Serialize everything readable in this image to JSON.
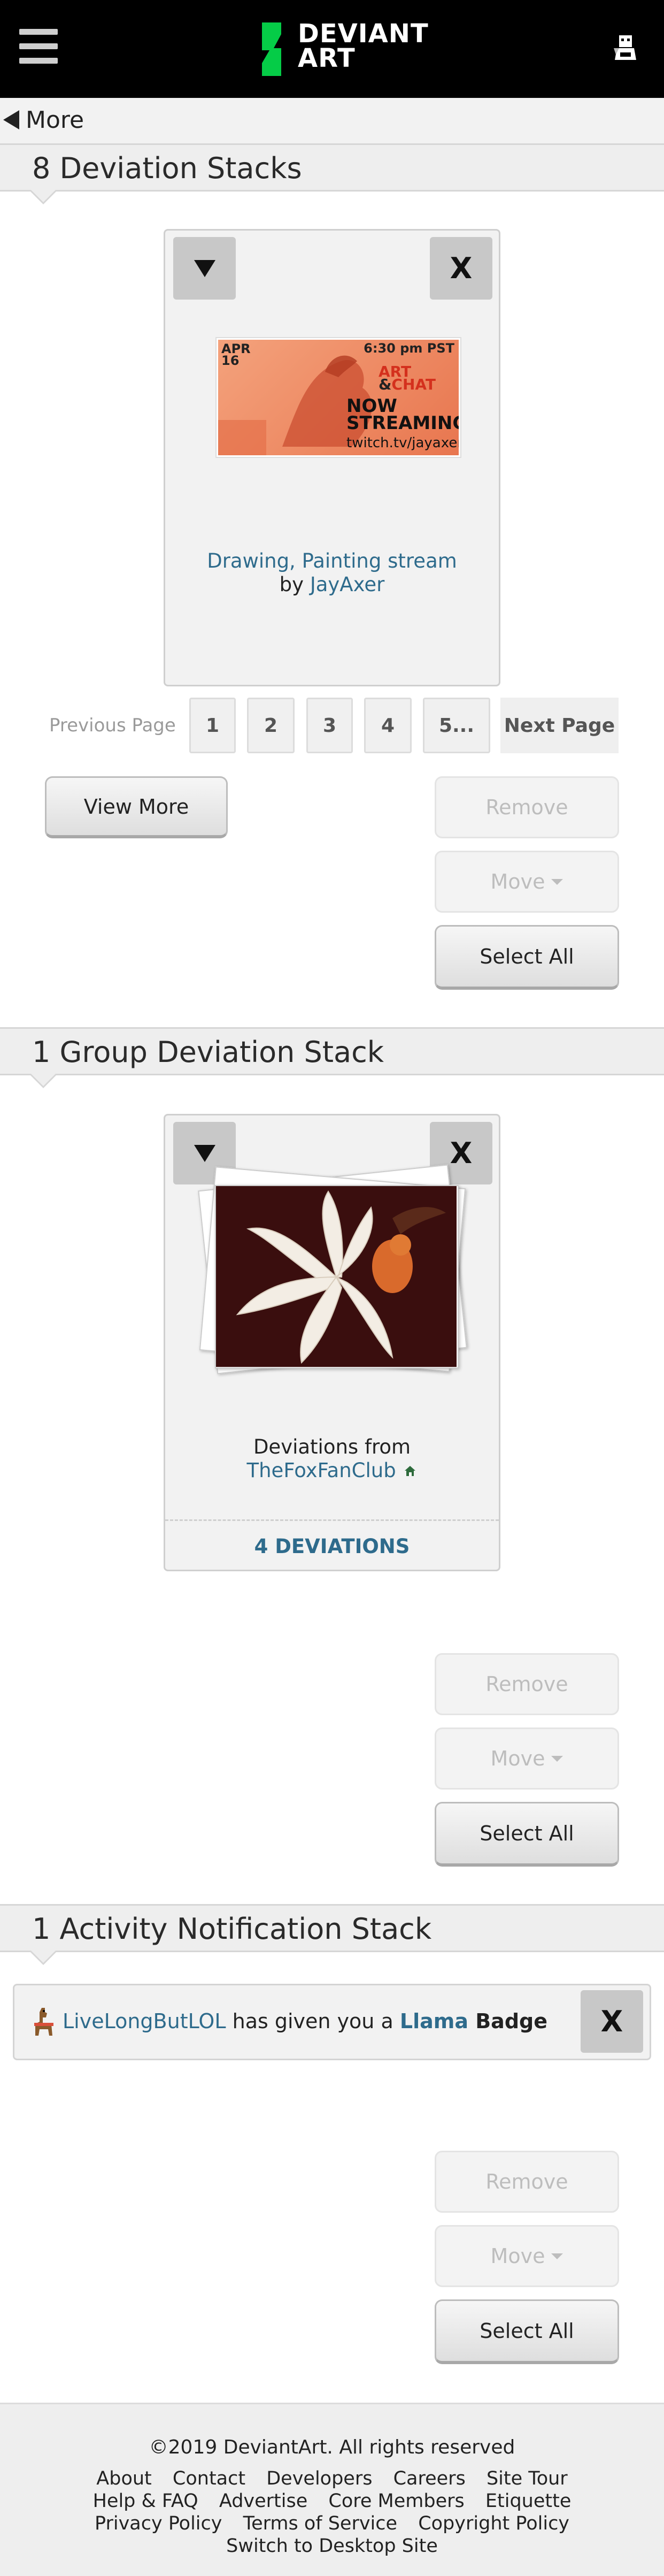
{
  "header": {
    "logo_line1": "DEVIANT",
    "logo_line2": "ART",
    "logo_color": "#05cc47"
  },
  "nav": {
    "more_label": "More"
  },
  "sections": {
    "deviations": {
      "title": "8 Deviation Stacks",
      "card": {
        "collapse_icon": "triangle-down-icon",
        "close_label": "X",
        "thumbnail": {
          "date_month": "APR",
          "date_day": "16",
          "time": "6:30 pm PST",
          "line_art": "ART",
          "line_amp": "&",
          "line_chat": "CHAT",
          "line_now": "NOW",
          "line_streaming": "STREAMING",
          "url": "twitch.tv/jayaxer"
        },
        "title": "Drawing, Painting stream",
        "by_label": "by",
        "author": "JayAxer"
      },
      "pagination": {
        "previous": "Previous Page",
        "pages": [
          "1",
          "2",
          "3",
          "4",
          "5..."
        ],
        "next": "Next Page"
      },
      "view_more": "View More",
      "remove": "Remove",
      "move": "Move",
      "select_all": "Select All"
    },
    "group": {
      "title": "1 Group Deviation Stack",
      "card": {
        "close_label": "X",
        "caption": "Deviations from",
        "group_name": "TheFoxFanClub",
        "count": "4 DEVIATIONS"
      },
      "remove": "Remove",
      "move": "Move",
      "select_all": "Select All"
    },
    "activity": {
      "title": "1 Activity Notification Stack",
      "notification": {
        "user": "LiveLongButLOL",
        "text": "has given you a",
        "badge": "Llama",
        "badge_suffix": "Badge",
        "close_label": "X"
      },
      "remove": "Remove",
      "move": "Move",
      "select_all": "Select All"
    }
  },
  "footer": {
    "copyright": "©2019 DeviantArt. All rights reserved",
    "links": [
      "About",
      "Contact",
      "Developers",
      "Careers",
      "Site Tour",
      "Help & FAQ",
      "Advertise",
      "Core Members",
      "Etiquette",
      "Privacy Policy",
      "Terms of Service",
      "Copyright Policy",
      "Switch to Desktop Site"
    ]
  }
}
